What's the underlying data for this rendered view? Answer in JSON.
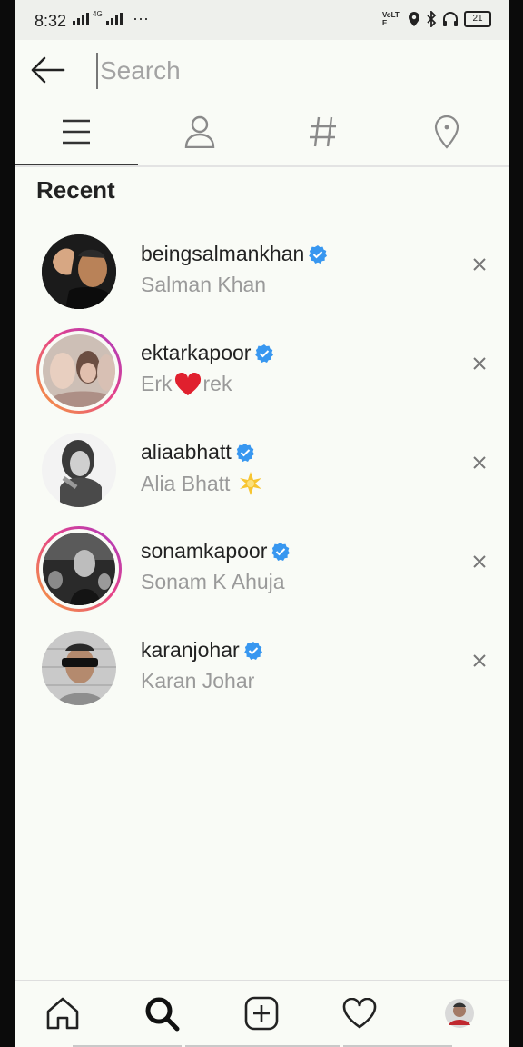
{
  "status_bar": {
    "time": "8:32",
    "network": "4G",
    "volte": "VoLTE",
    "battery": "21"
  },
  "search": {
    "placeholder": "Search"
  },
  "tabs": [
    {
      "name": "top",
      "icon": "menu-lines-icon",
      "active": true
    },
    {
      "name": "accounts",
      "icon": "person-icon",
      "active": false
    },
    {
      "name": "tags",
      "icon": "hashtag-icon",
      "active": false
    },
    {
      "name": "places",
      "icon": "location-pin-icon",
      "active": false
    }
  ],
  "recent": {
    "title": "Recent",
    "items": [
      {
        "username": "beingsalmankhan",
        "fullname_pre": "Salman Khan",
        "fullname_post": "",
        "emoji": "",
        "story_ring": false,
        "verified": true
      },
      {
        "username": "ektarkapoor",
        "fullname_pre": "Erk",
        "fullname_post": "rek",
        "emoji": "heart",
        "story_ring": true,
        "verified": true
      },
      {
        "username": "aliaabhatt",
        "fullname_pre": "Alia Bhatt ",
        "fullname_post": "",
        "emoji": "sparkle",
        "story_ring": false,
        "verified": true
      },
      {
        "username": "sonamkapoor",
        "fullname_pre": "Sonam K Ahuja",
        "fullname_post": "",
        "emoji": "",
        "story_ring": true,
        "verified": true
      },
      {
        "username": "karanjohar",
        "fullname_pre": "Karan Johar",
        "fullname_post": "",
        "emoji": "",
        "story_ring": false,
        "verified": true
      }
    ]
  },
  "bottom_nav": [
    {
      "name": "home",
      "icon": "home-icon"
    },
    {
      "name": "search",
      "icon": "search-icon",
      "active": true
    },
    {
      "name": "new-post",
      "icon": "plus-square-icon"
    },
    {
      "name": "activity",
      "icon": "heart-icon"
    },
    {
      "name": "profile",
      "icon": "profile-avatar-icon"
    }
  ],
  "colors": {
    "verified": "#3897f0",
    "heart": "#e0202e",
    "muted_text": "#9a9a9a",
    "ring_start": "#f6a03a",
    "ring_end": "#a63ac2"
  }
}
